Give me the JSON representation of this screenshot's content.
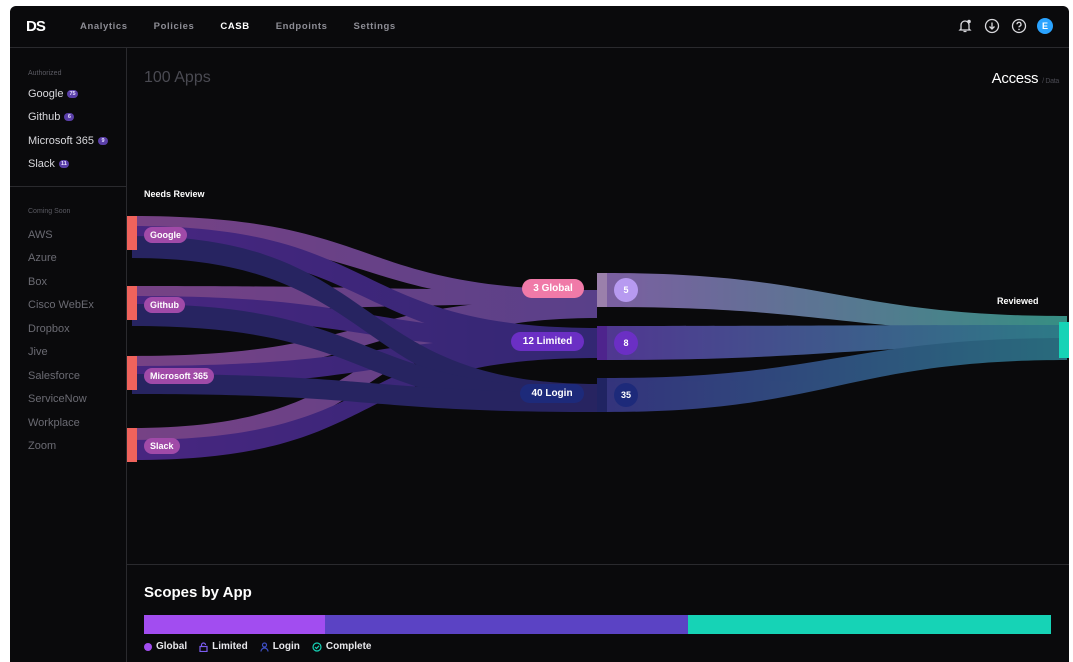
{
  "app": {
    "logo": "DS"
  },
  "nav": [
    {
      "label": "Analytics",
      "active": false
    },
    {
      "label": "Policies",
      "active": false
    },
    {
      "label": "CASB",
      "active": true
    },
    {
      "label": "Endpoints",
      "active": false
    },
    {
      "label": "Settings",
      "active": false
    }
  ],
  "user": {
    "initial": "E"
  },
  "sidebar": {
    "authorized_heading": "Authorized",
    "authorized": [
      {
        "label": "Google",
        "count": "75"
      },
      {
        "label": "Github",
        "count": "6"
      },
      {
        "label": "Microsoft 365",
        "count": "9"
      },
      {
        "label": "Slack",
        "count": "11"
      }
    ],
    "soon_heading": "Coming Soon",
    "soon": [
      "AWS",
      "Azure",
      "Box",
      "Cisco WebEx",
      "Dropbox",
      "Jive",
      "Salesforce",
      "ServiceNow",
      "Workplace",
      "Zoom"
    ]
  },
  "main": {
    "title": "100 Apps",
    "view": "Access",
    "view_sub": "/ Data",
    "left_label": "Needs Review",
    "right_label": "Reviewed"
  },
  "sankey": {
    "sources": [
      "Google",
      "Github",
      "Microsoft 365",
      "Slack"
    ],
    "middle": [
      {
        "label": "3 Global",
        "reviewed": "5",
        "color": "#f07aa8",
        "badge": "#b79af0"
      },
      {
        "label": "12 Limited",
        "reviewed": "8",
        "color": "#6b2fc4",
        "badge": "#6b2fc4"
      },
      {
        "label": "40 Login",
        "reviewed": "35",
        "color": "#1d2a7a",
        "badge": "#1d2a7a"
      }
    ]
  },
  "scopes": {
    "title": "Scopes by App",
    "segments": [
      {
        "name": "Global",
        "fraction": 0.2,
        "color": "#a24df0"
      },
      {
        "name": "Limited",
        "fraction": 0.4,
        "color": "#5b43c4"
      },
      {
        "name": "Complete",
        "fraction": 0.4,
        "color": "#16d3b6"
      }
    ],
    "legend": [
      {
        "label": "Global",
        "color": "#a24df0"
      },
      {
        "label": "Limited",
        "color": "#7b5cf0"
      },
      {
        "label": "Login",
        "color": "#3d4ec4"
      },
      {
        "label": "Complete",
        "color": "#16d3b6"
      }
    ]
  }
}
